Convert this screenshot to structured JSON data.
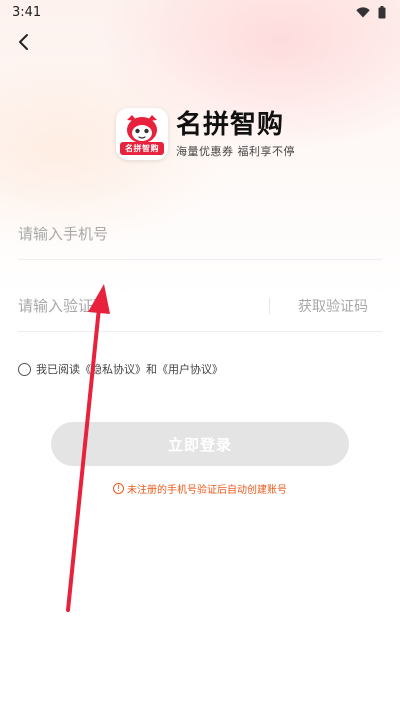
{
  "status_bar": {
    "time": "3:41",
    "icons": [
      "wifi-icon",
      "battery-icon"
    ]
  },
  "nav": {
    "back_icon": "chevron-left-icon"
  },
  "brand": {
    "logo_badge": "名拼智购",
    "name": "名拼智购",
    "slogan": "海量优惠券 福利享不停",
    "accent_color": "#e8223d"
  },
  "form": {
    "phone_placeholder": "请输入手机号",
    "phone_value": "",
    "code_placeholder": "请输入验证码",
    "code_value": "",
    "get_code_label": "获取验证码"
  },
  "agreement": {
    "checked": false,
    "prefix": "我已阅读",
    "privacy_link": "《隐私协议》",
    "conjunction": "和",
    "user_link": "《用户协议》"
  },
  "login_button": {
    "label": "立即登录",
    "enabled": false
  },
  "notice": {
    "text": "未注册的手机号验证后自动创建账号",
    "color": "#e85a1c"
  },
  "overlay": {
    "annotation": "red-arrow",
    "color": "#e8223d"
  }
}
